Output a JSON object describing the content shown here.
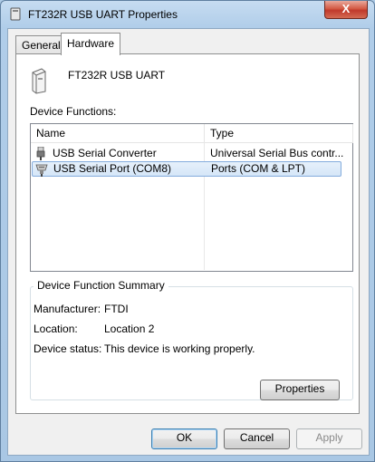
{
  "window": {
    "title": "FT232R USB UART Properties",
    "close_label": "X"
  },
  "tabs": [
    {
      "label": "General"
    },
    {
      "label": "Hardware"
    }
  ],
  "device": {
    "name": "FT232R USB UART"
  },
  "device_functions": {
    "label": "Device Functions:",
    "columns": {
      "name": "Name",
      "type": "Type"
    },
    "rows": [
      {
        "name": "USB Serial Converter",
        "type": "Universal Serial Bus contr..."
      },
      {
        "name": "USB Serial Port (COM8)",
        "type": "Ports (COM & LPT)"
      }
    ]
  },
  "summary": {
    "title": "Device Function Summary",
    "manufacturer_label": "Manufacturer:",
    "manufacturer": "FTDI",
    "location_label": "Location:",
    "location": "Location 2",
    "status_label": "Device status:",
    "status": "This device is working properly."
  },
  "buttons": {
    "properties": "Properties",
    "ok": "OK",
    "cancel": "Cancel",
    "apply": "Apply"
  }
}
